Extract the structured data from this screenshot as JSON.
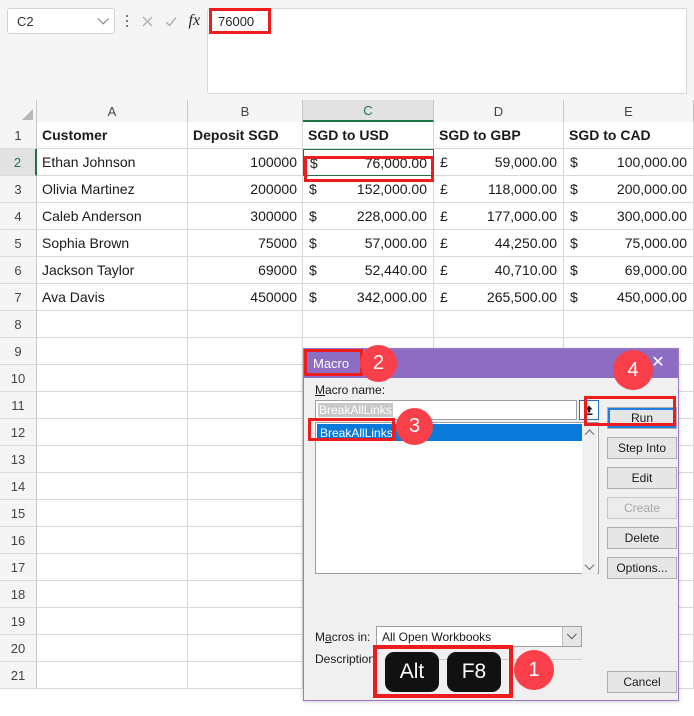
{
  "formula_bar": {
    "name_box_value": "C2",
    "formula_value": "76000",
    "cancel_icon": "x-icon",
    "confirm_icon": "check-icon",
    "function_icon": "fx-icon"
  },
  "grid": {
    "columns": [
      "A",
      "B",
      "C",
      "D",
      "E"
    ],
    "selected_column": "C",
    "selected_row": "2",
    "rows": [
      "1",
      "2",
      "3",
      "4",
      "5",
      "6",
      "7",
      "8",
      "9",
      "10",
      "11",
      "12",
      "13",
      "14",
      "15",
      "16",
      "17",
      "18",
      "19",
      "20",
      "21"
    ],
    "headers": [
      "Customer",
      "Deposit SGD",
      "SGD to USD",
      "SGD to GBP",
      "SGD to CAD"
    ],
    "data": [
      {
        "customer": "Ethan Johnson",
        "deposit": "100000",
        "usd_sym": "$",
        "usd": "76,000.00",
        "gbp_sym": "£",
        "gbp": "59,000.00",
        "cad_sym": "$",
        "cad": "100,000.00"
      },
      {
        "customer": "Olivia Martinez",
        "deposit": "200000",
        "usd_sym": "$",
        "usd": "152,000.00",
        "gbp_sym": "£",
        "gbp": "118,000.00",
        "cad_sym": "$",
        "cad": "200,000.00"
      },
      {
        "customer": "Caleb Anderson",
        "deposit": "300000",
        "usd_sym": "$",
        "usd": "228,000.00",
        "gbp_sym": "£",
        "gbp": "177,000.00",
        "cad_sym": "$",
        "cad": "300,000.00"
      },
      {
        "customer": "Sophia Brown",
        "deposit": "75000",
        "usd_sym": "$",
        "usd": "57,000.00",
        "gbp_sym": "£",
        "gbp": "44,250.00",
        "cad_sym": "$",
        "cad": "75,000.00"
      },
      {
        "customer": "Jackson Taylor",
        "deposit": "69000",
        "usd_sym": "$",
        "usd": "52,440.00",
        "gbp_sym": "£",
        "gbp": "40,710.00",
        "cad_sym": "$",
        "cad": "69,000.00"
      },
      {
        "customer": "Ava Davis",
        "deposit": "450000",
        "usd_sym": "$",
        "usd": "342,000.00",
        "gbp_sym": "£",
        "gbp": "265,500.00",
        "cad_sym": "$",
        "cad": "450,000.00"
      }
    ]
  },
  "dialog": {
    "title": "Macro",
    "help_glyph": "?",
    "close_glyph": "✕",
    "macro_name_label": "Macro name:",
    "macro_name_value": "BreakAllLinks",
    "list_items": [
      "BreakAllLinks"
    ],
    "buttons": [
      {
        "label": "Run",
        "state": "focused"
      },
      {
        "label": "Step Into",
        "state": "normal"
      },
      {
        "label": "Edit",
        "state": "normal"
      },
      {
        "label": "Create",
        "state": "disabled"
      },
      {
        "label": "Delete",
        "state": "normal"
      },
      {
        "label": "Options...",
        "state": "normal"
      }
    ],
    "cancel_label": "Cancel",
    "macros_in_label": "Macros in:",
    "macros_in_value": "All Open Workbooks",
    "description_label": "Description"
  },
  "overlay": {
    "keys": [
      "Alt",
      "F8"
    ],
    "badges": [
      "1",
      "2",
      "3",
      "4"
    ],
    "accent_red": "#ee1c1c",
    "badge_red": "#f9404a",
    "dialog_purple": "#8d6cc4",
    "excel_green": "#217346",
    "selection_blue": "#0a7ada"
  }
}
